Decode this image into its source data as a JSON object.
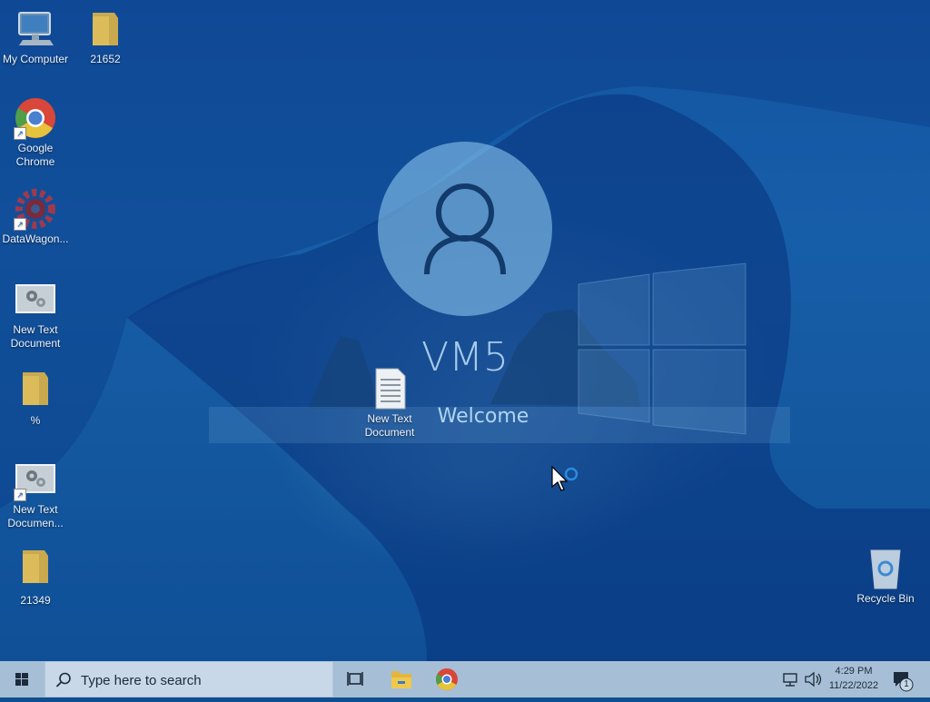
{
  "desktop": {
    "icons": [
      {
        "label": "My Computer",
        "icon": "computer-icon"
      },
      {
        "label": "21652",
        "icon": "folder-icon"
      },
      {
        "label": "Google Chrome",
        "icon": "chrome-icon"
      },
      {
        "label": "DataWagon...",
        "icon": "gear-app-icon"
      },
      {
        "label": "New Text Document",
        "icon": "settings-document-icon"
      },
      {
        "label": "%",
        "icon": "folder-icon"
      },
      {
        "label": "New Text Documen...",
        "icon": "settings-document-icon"
      },
      {
        "label": "21349",
        "icon": "folder-icon"
      },
      {
        "label": "New Text Document",
        "icon": "text-document-icon"
      },
      {
        "label": "Recycle Bin",
        "icon": "recycle-bin-icon"
      }
    ]
  },
  "welcome": {
    "machine_name": "VM5",
    "message": "Welcome"
  },
  "taskbar": {
    "search_placeholder": "Type here to search",
    "time": "4:29 PM",
    "date": "11/22/2022",
    "notification_count": "1"
  },
  "colors": {
    "taskbar": "#a7bfd6",
    "accent": "#1a62a8"
  }
}
